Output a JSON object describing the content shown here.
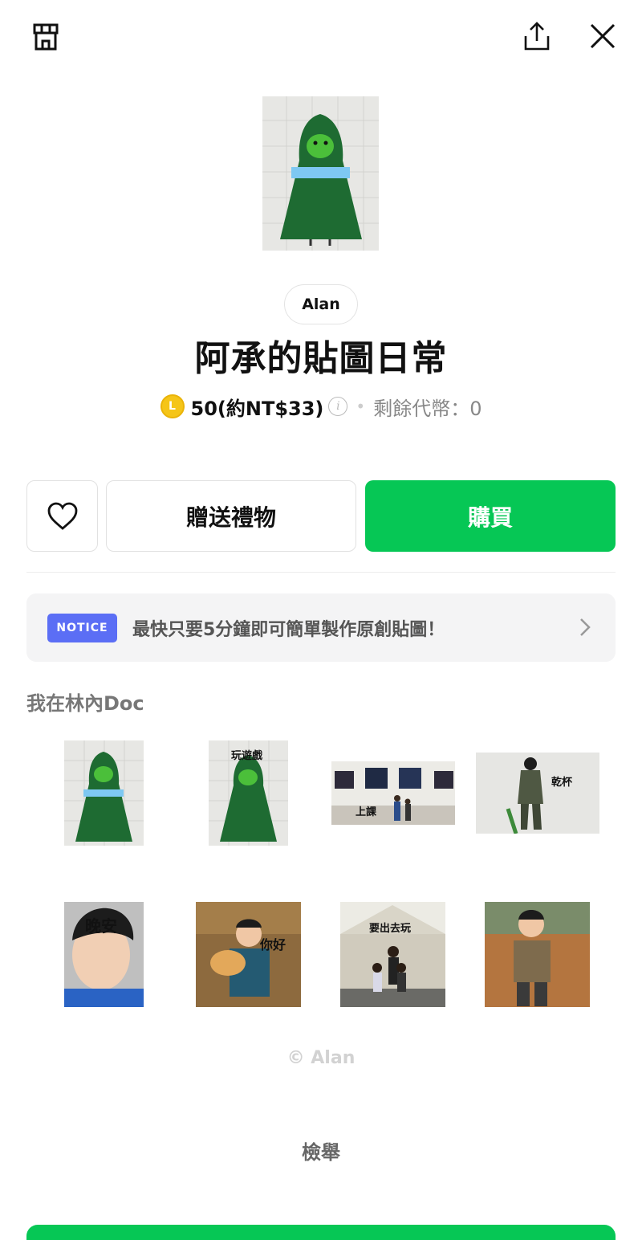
{
  "header": {
    "shop_icon": "shop-icon",
    "share_icon": "share-icon",
    "close_icon": "close-icon"
  },
  "product": {
    "author": "Alan",
    "title": "阿承的貼圖日常",
    "coin_symbol": "L",
    "price": "50(約NT$33)",
    "info_symbol": "i",
    "separator": "•",
    "remaining_coins": "剩餘代幣：0"
  },
  "actions": {
    "favorite_icon": "heart-icon",
    "gift_label": "贈送禮物",
    "buy_label": "購買"
  },
  "notice": {
    "badge": "NOTICE",
    "text": "最快只要5分鐘即可簡單製作原創貼圖！"
  },
  "sticker_section": {
    "label": "我在林內Doc",
    "stickers": [
      {
        "caption": ""
      },
      {
        "caption": "玩遊戲"
      },
      {
        "caption": "上課"
      },
      {
        "caption": "乾杯"
      },
      {
        "caption": "晚安"
      },
      {
        "caption": "你好"
      },
      {
        "caption": "要出去玩"
      },
      {
        "caption": ""
      }
    ]
  },
  "footer": {
    "copyright": "© Alan",
    "report_label": "檢舉"
  },
  "colors": {
    "brand_green": "#06c755",
    "notice_badge": "#5b6ef5",
    "coin": "#f5c518"
  }
}
